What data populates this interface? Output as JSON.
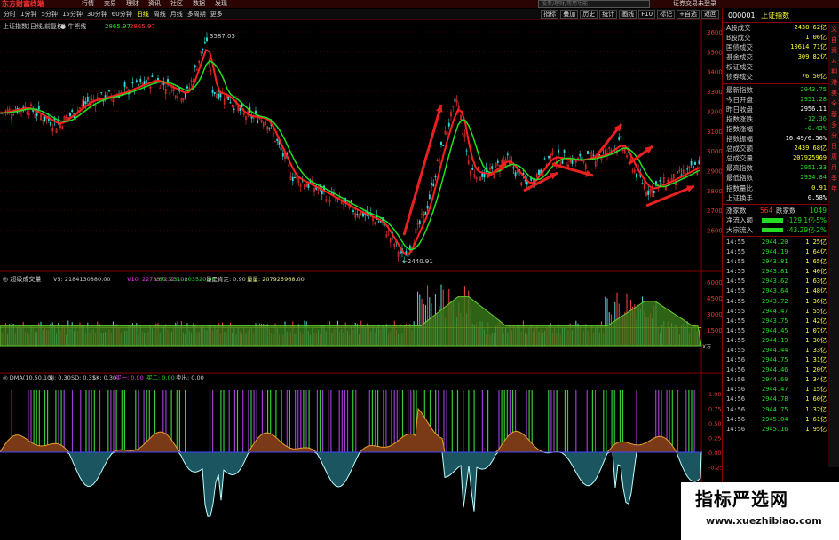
{
  "app": {
    "logo": "东方财富终端",
    "menu": [
      "行情",
      "交易",
      "理财",
      "资讯",
      "社区",
      "数据",
      "发现"
    ],
    "search_placeholder": "股票/理财/常用功能",
    "login": "证券交易未登录"
  },
  "toolbar": {
    "periods": [
      "分时",
      "1分钟",
      "5分钟",
      "15分钟",
      "30分钟",
      "60分钟",
      "日线",
      "周线",
      "月线",
      "多周期",
      "更多"
    ],
    "selected": "日线",
    "tools": [
      "指标",
      "叠加",
      "历史",
      "统计",
      "画线",
      "F10",
      "标记",
      "+自选",
      "返回"
    ]
  },
  "main": {
    "title": "上证指数(日线,前复权)",
    "ma_name": "牛熊线",
    "ma_value": "2865.97",
    "extra_value": "2865.97",
    "high_label": "3587.03",
    "low_label": "2440.91",
    "y_ticks": [
      "3600",
      "3500",
      "3400",
      "3300",
      "3200",
      "3100",
      "3000",
      "2900",
      "2800",
      "2700",
      "2600"
    ]
  },
  "volume": {
    "title": "超级成交量",
    "v5": "V5: 2184130880.00",
    "v10": "V10: 2278372320.00",
    "v60": "V60: 2310203520.00",
    "vlabel": "量是肯定: 0.90",
    "lvlabel": "量量: 207925968.00",
    "y_ticks": [
      "60000",
      "45000",
      "30000",
      "15000"
    ],
    "unit": "X万"
  },
  "dma": {
    "title": "DMA(10,50,10)",
    "sj": "SJ: 0.30",
    "sd": "SD: 0.31",
    "sk": "SK: 0.30",
    "buy1": "买一: 0.00",
    "buy2": "买二: 0.00",
    "sell": "卖出: 0.00",
    "y_ticks": [
      "1.00",
      "0.75",
      "0.50",
      "0.25",
      "0.00",
      "-0.25"
    ]
  },
  "quote": {
    "code": "000001",
    "name": "上证指数",
    "rows": [
      {
        "label": "A股成交",
        "value": "2438.62亿",
        "color": "#ff3"
      },
      {
        "label": "B股成交",
        "value": "1.06亿",
        "color": "#ff3"
      },
      {
        "label": "国债成交",
        "value": "10614.71亿",
        "color": "#ff3"
      },
      {
        "label": "基金成交",
        "value": "309.82亿",
        "color": "#ff3"
      },
      {
        "label": "权证成交",
        "value": "",
        "color": "#ff3"
      },
      {
        "label": "债券成交",
        "value": "76.50亿",
        "color": "#ff3"
      }
    ],
    "rows2": [
      {
        "label": "最新指数",
        "value": "2943.75",
        "color": "#2d2"
      },
      {
        "label": "今日开盘",
        "value": "2951.28",
        "color": "#2d2"
      },
      {
        "label": "昨日收盘",
        "value": "2956.11",
        "color": "#fff"
      },
      {
        "label": "指数涨跌",
        "value": "-12.36",
        "color": "#2d2"
      },
      {
        "label": "指数涨幅",
        "value": "-0.42%",
        "color": "#2d2"
      },
      {
        "label": "指数振幅",
        "value": "16.49/0.56%",
        "color": "#fff"
      },
      {
        "label": "总成交额",
        "value": "2439.68亿",
        "color": "#ff3"
      },
      {
        "label": "总成交量",
        "value": "207925969",
        "color": "#ff3"
      },
      {
        "label": "最高指数",
        "value": "2951.33",
        "color": "#2d2"
      },
      {
        "label": "最低指数",
        "value": "2934.84",
        "color": "#2d2"
      },
      {
        "label": "指数量比",
        "value": "0.91",
        "color": "#ff3"
      },
      {
        "label": "上证换手",
        "value": "0.58%",
        "color": "#fff"
      }
    ],
    "breadth": {
      "up_label": "涨家数",
      "up": "564",
      "down_label": "跌家数",
      "down": "1049"
    },
    "flow": [
      {
        "label": "净流入额",
        "value": "-129.1亿",
        "pct": "-5%"
      },
      {
        "label": "大宗流入",
        "value": "-43.29亿",
        "pct": "-2%"
      }
    ],
    "ticks": [
      {
        "t": "14:55",
        "p": "2944.20",
        "v": "1.25亿"
      },
      {
        "t": "14:55",
        "p": "2944.19",
        "v": "1.64亿"
      },
      {
        "t": "14:55",
        "p": "2943.81",
        "v": "1.65亿"
      },
      {
        "t": "14:55",
        "p": "2943.81",
        "v": "1.40亿"
      },
      {
        "t": "14:55",
        "p": "2943.62",
        "v": "1.63亿"
      },
      {
        "t": "14:55",
        "p": "2943.64",
        "v": "1.48亿"
      },
      {
        "t": "14:55",
        "p": "2943.72",
        "v": "1.36亿"
      },
      {
        "t": "14:55",
        "p": "2944.47",
        "v": "1.55亿"
      },
      {
        "t": "14:55",
        "p": "2943.75",
        "v": "1.42亿"
      },
      {
        "t": "14:55",
        "p": "2944.45",
        "v": "1.07亿"
      },
      {
        "t": "14:55",
        "p": "2944.19",
        "v": "1.30亿"
      },
      {
        "t": "14:55",
        "p": "2944.44",
        "v": "1.33亿"
      },
      {
        "t": "14:56",
        "p": "2944.75",
        "v": "1.31亿"
      },
      {
        "t": "14:56",
        "p": "2944.46",
        "v": "1.20亿"
      },
      {
        "t": "14:56",
        "p": "2944.60",
        "v": "1.34亿"
      },
      {
        "t": "14:56",
        "p": "2944.47",
        "v": "1.15亿"
      },
      {
        "t": "14:56",
        "p": "2944.78",
        "v": "1.60亿"
      },
      {
        "t": "14:56",
        "p": "2944.75",
        "v": "1.32亿"
      },
      {
        "t": "14:56",
        "p": "2945.04",
        "v": "1.61亿"
      },
      {
        "t": "14:56",
        "p": "2945.16",
        "v": "1.95亿"
      }
    ]
  },
  "sidebar": [
    "文",
    "自",
    "资",
    "A",
    "期",
    "港",
    "美",
    "全",
    "基",
    "多",
    "分",
    "日",
    "周",
    "月",
    "季",
    "年"
  ],
  "watermark": {
    "title": "指标严选网",
    "url": "www.xuezhibiao.com"
  }
}
